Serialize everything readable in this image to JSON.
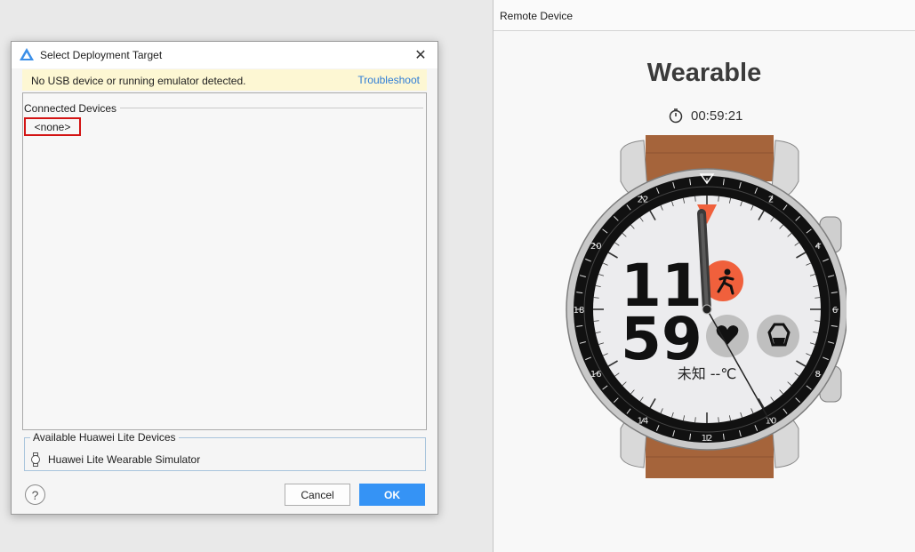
{
  "dialog": {
    "title": "Select Deployment Target",
    "close_glyph": "✕",
    "warning": {
      "message": "No USB device or running emulator detected.",
      "link": "Troubleshoot"
    },
    "connected": {
      "legend": "Connected Devices",
      "items": [
        "<none>"
      ]
    },
    "lite": {
      "legend": "Available Huawei Lite Devices",
      "items": [
        "Huawei Lite Wearable Simulator"
      ]
    },
    "help_glyph": "?",
    "cancel_label": "Cancel",
    "ok_label": "OK"
  },
  "remote": {
    "title": "Remote Device",
    "device_name": "Wearable",
    "timer": "00:59:21",
    "watch": {
      "hours": "11",
      "minutes": "59",
      "weather": "未知 --℃",
      "bezel_labels": [
        "2",
        "4",
        "6",
        "8",
        "10",
        "12",
        "14",
        "16",
        "18",
        "20",
        "22"
      ]
    }
  },
  "colors": {
    "accent": "#3593f5",
    "warning_bg": "#fdf7d3",
    "highlight": "#d31414",
    "watch_orange": "#f0603c",
    "strap": "#a5643b"
  },
  "icons": [
    "app-logo-icon",
    "close-icon",
    "watch-icon",
    "help-icon",
    "stopwatch-icon",
    "running-icon",
    "heart-icon",
    "stress-icon"
  ]
}
